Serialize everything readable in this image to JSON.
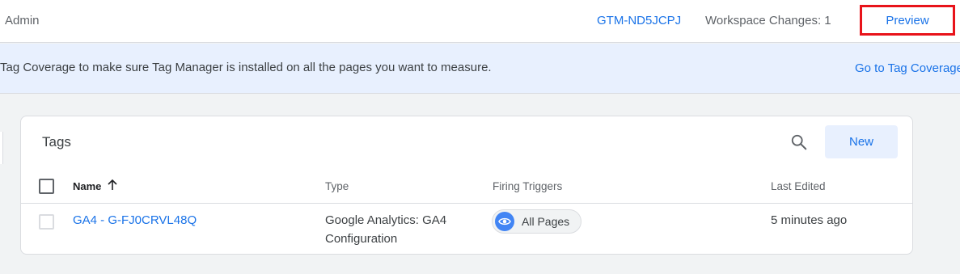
{
  "topbar": {
    "admin_label": "Admin",
    "container_id": "GTM-ND5JCPJ",
    "workspace_changes": "Workspace Changes: 1",
    "preview_label": "Preview"
  },
  "banner": {
    "message": "Tag Coverage to make sure Tag Manager is installed on all the pages you want to measure.",
    "link_label": "Go to Tag Coverage"
  },
  "tags_card": {
    "title": "Tags",
    "new_label": "New",
    "columns": {
      "name": "Name",
      "type": "Type",
      "firing_triggers": "Firing Triggers",
      "last_edited": "Last Edited"
    },
    "rows": [
      {
        "name": "GA4 - G-FJ0CRVL48Q",
        "type": "Google Analytics: GA4 Configuration",
        "trigger": "All Pages",
        "last_edited": "5 minutes ago"
      }
    ]
  },
  "colors": {
    "accent": "#1a73e8",
    "highlight_border": "#e8131a",
    "banner_bg": "#e8f0fe",
    "trigger_icon_bg": "#4285f4"
  },
  "icons": {
    "search": "search-icon",
    "sort": "arrow-up-icon",
    "trigger": "eye-icon"
  }
}
